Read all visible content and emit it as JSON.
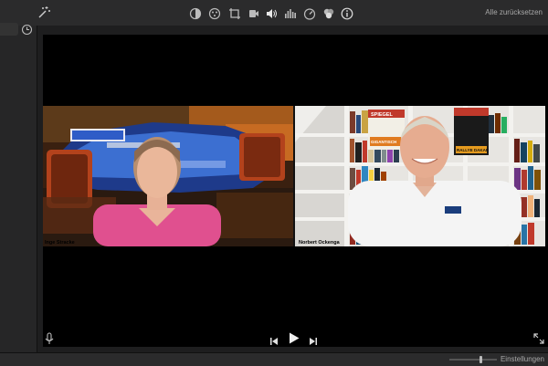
{
  "toolbar": {
    "reset_label": "Alle zurücksetzen",
    "tools": [
      "color-balance-icon",
      "color-correction-icon",
      "crop-icon",
      "stabilization-icon",
      "volume-icon",
      "noise-reduction-icon",
      "speed-icon",
      "video-overlay-icon",
      "info-icon"
    ]
  },
  "video": {
    "left_name": "Inge Stracke",
    "right_name": "Norbert Ockenga",
    "poster_top": "SPIEGEL",
    "book_rallye": "RALLYE DAKAR",
    "book_gigantische": "GIGANTISCH"
  },
  "bottom": {
    "settings_label": "Einstellungen",
    "zoom_level": 0.65
  },
  "colors": {
    "toolbar_bg": "#2b2b2c",
    "viewer_bg": "#000000",
    "shirt_left": "#e0508f",
    "shirt_right": "#f4f4f4"
  }
}
